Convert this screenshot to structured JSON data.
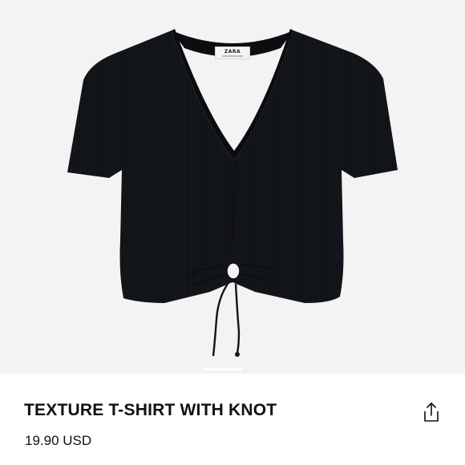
{
  "product": {
    "brand": "ZARA",
    "title": "TEXTURE T-SHIRT WITH KNOT",
    "price": "19.90 USD",
    "image_icon": "black-knot-tshirt",
    "garment_color": "#111418",
    "background_color": "#f3f3f3"
  },
  "carousel": {
    "indicator_color": "#ffffff"
  },
  "share": {
    "icon": "share-icon"
  }
}
